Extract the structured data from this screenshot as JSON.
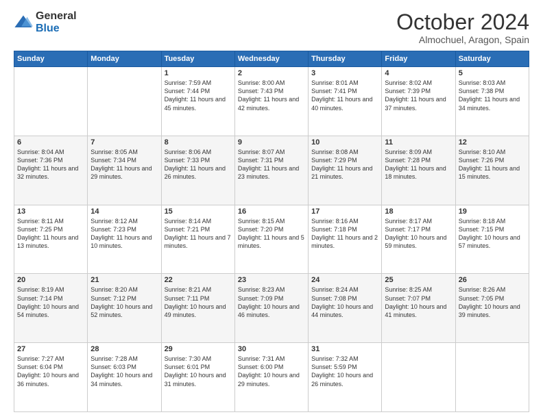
{
  "logo": {
    "general": "General",
    "blue": "Blue"
  },
  "title": "October 2024",
  "location": "Almochuel, Aragon, Spain",
  "weekdays": [
    "Sunday",
    "Monday",
    "Tuesday",
    "Wednesday",
    "Thursday",
    "Friday",
    "Saturday"
  ],
  "weeks": [
    [
      {
        "day": "",
        "info": ""
      },
      {
        "day": "",
        "info": ""
      },
      {
        "day": "1",
        "info": "Sunrise: 7:59 AM\nSunset: 7:44 PM\nDaylight: 11 hours and 45 minutes."
      },
      {
        "day": "2",
        "info": "Sunrise: 8:00 AM\nSunset: 7:43 PM\nDaylight: 11 hours and 42 minutes."
      },
      {
        "day": "3",
        "info": "Sunrise: 8:01 AM\nSunset: 7:41 PM\nDaylight: 11 hours and 40 minutes."
      },
      {
        "day": "4",
        "info": "Sunrise: 8:02 AM\nSunset: 7:39 PM\nDaylight: 11 hours and 37 minutes."
      },
      {
        "day": "5",
        "info": "Sunrise: 8:03 AM\nSunset: 7:38 PM\nDaylight: 11 hours and 34 minutes."
      }
    ],
    [
      {
        "day": "6",
        "info": "Sunrise: 8:04 AM\nSunset: 7:36 PM\nDaylight: 11 hours and 32 minutes."
      },
      {
        "day": "7",
        "info": "Sunrise: 8:05 AM\nSunset: 7:34 PM\nDaylight: 11 hours and 29 minutes."
      },
      {
        "day": "8",
        "info": "Sunrise: 8:06 AM\nSunset: 7:33 PM\nDaylight: 11 hours and 26 minutes."
      },
      {
        "day": "9",
        "info": "Sunrise: 8:07 AM\nSunset: 7:31 PM\nDaylight: 11 hours and 23 minutes."
      },
      {
        "day": "10",
        "info": "Sunrise: 8:08 AM\nSunset: 7:29 PM\nDaylight: 11 hours and 21 minutes."
      },
      {
        "day": "11",
        "info": "Sunrise: 8:09 AM\nSunset: 7:28 PM\nDaylight: 11 hours and 18 minutes."
      },
      {
        "day": "12",
        "info": "Sunrise: 8:10 AM\nSunset: 7:26 PM\nDaylight: 11 hours and 15 minutes."
      }
    ],
    [
      {
        "day": "13",
        "info": "Sunrise: 8:11 AM\nSunset: 7:25 PM\nDaylight: 11 hours and 13 minutes."
      },
      {
        "day": "14",
        "info": "Sunrise: 8:12 AM\nSunset: 7:23 PM\nDaylight: 11 hours and 10 minutes."
      },
      {
        "day": "15",
        "info": "Sunrise: 8:14 AM\nSunset: 7:21 PM\nDaylight: 11 hours and 7 minutes."
      },
      {
        "day": "16",
        "info": "Sunrise: 8:15 AM\nSunset: 7:20 PM\nDaylight: 11 hours and 5 minutes."
      },
      {
        "day": "17",
        "info": "Sunrise: 8:16 AM\nSunset: 7:18 PM\nDaylight: 11 hours and 2 minutes."
      },
      {
        "day": "18",
        "info": "Sunrise: 8:17 AM\nSunset: 7:17 PM\nDaylight: 10 hours and 59 minutes."
      },
      {
        "day": "19",
        "info": "Sunrise: 8:18 AM\nSunset: 7:15 PM\nDaylight: 10 hours and 57 minutes."
      }
    ],
    [
      {
        "day": "20",
        "info": "Sunrise: 8:19 AM\nSunset: 7:14 PM\nDaylight: 10 hours and 54 minutes."
      },
      {
        "day": "21",
        "info": "Sunrise: 8:20 AM\nSunset: 7:12 PM\nDaylight: 10 hours and 52 minutes."
      },
      {
        "day": "22",
        "info": "Sunrise: 8:21 AM\nSunset: 7:11 PM\nDaylight: 10 hours and 49 minutes."
      },
      {
        "day": "23",
        "info": "Sunrise: 8:23 AM\nSunset: 7:09 PM\nDaylight: 10 hours and 46 minutes."
      },
      {
        "day": "24",
        "info": "Sunrise: 8:24 AM\nSunset: 7:08 PM\nDaylight: 10 hours and 44 minutes."
      },
      {
        "day": "25",
        "info": "Sunrise: 8:25 AM\nSunset: 7:07 PM\nDaylight: 10 hours and 41 minutes."
      },
      {
        "day": "26",
        "info": "Sunrise: 8:26 AM\nSunset: 7:05 PM\nDaylight: 10 hours and 39 minutes."
      }
    ],
    [
      {
        "day": "27",
        "info": "Sunrise: 7:27 AM\nSunset: 6:04 PM\nDaylight: 10 hours and 36 minutes."
      },
      {
        "day": "28",
        "info": "Sunrise: 7:28 AM\nSunset: 6:03 PM\nDaylight: 10 hours and 34 minutes."
      },
      {
        "day": "29",
        "info": "Sunrise: 7:30 AM\nSunset: 6:01 PM\nDaylight: 10 hours and 31 minutes."
      },
      {
        "day": "30",
        "info": "Sunrise: 7:31 AM\nSunset: 6:00 PM\nDaylight: 10 hours and 29 minutes."
      },
      {
        "day": "31",
        "info": "Sunrise: 7:32 AM\nSunset: 5:59 PM\nDaylight: 10 hours and 26 minutes."
      },
      {
        "day": "",
        "info": ""
      },
      {
        "day": "",
        "info": ""
      }
    ]
  ]
}
